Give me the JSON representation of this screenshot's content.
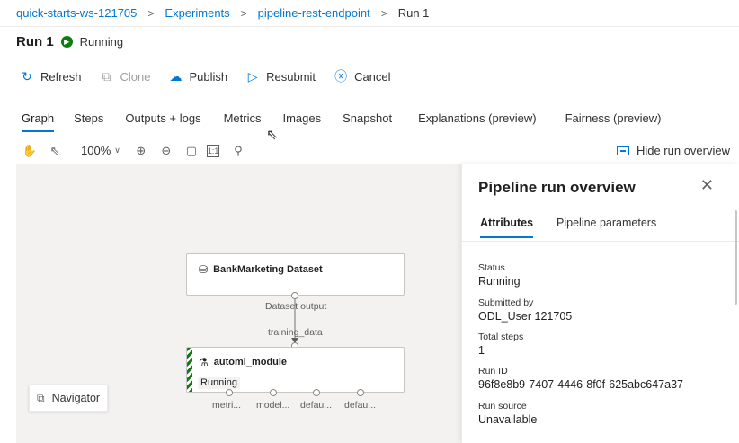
{
  "breadcrumb": {
    "items": [
      "quick-starts-ws-121705",
      "Experiments",
      "pipeline-rest-endpoint",
      "Run 1"
    ],
    "separator": ">"
  },
  "header": {
    "title": "Run 1",
    "status": "Running",
    "status_color": "#107c10"
  },
  "toolbar": {
    "refresh_label": "Refresh",
    "clone_label": "Clone",
    "publish_label": "Publish",
    "resubmit_label": "Resubmit",
    "cancel_label": "Cancel"
  },
  "tabs": [
    {
      "label": "Graph",
      "active": true
    },
    {
      "label": "Steps"
    },
    {
      "label": "Outputs + logs"
    },
    {
      "label": "Metrics"
    },
    {
      "label": "Images"
    },
    {
      "label": "Snapshot"
    },
    {
      "label": "Explanations (preview)"
    },
    {
      "label": "Fairness (preview)"
    }
  ],
  "graph_toolbar": {
    "zoom": "100%",
    "hide_overview_label": "Hide run overview"
  },
  "graph": {
    "dataset_node": {
      "title": "BankMarketing Dataset",
      "output_port": "Dataset output"
    },
    "module_node": {
      "input_port": "training_data",
      "title": "automl_module",
      "status": "Running",
      "output_ports": [
        "metri...",
        "model...",
        "defau...",
        "defau..."
      ]
    },
    "navigator_label": "Navigator"
  },
  "overview": {
    "title": "Pipeline run overview",
    "tabs": [
      "Attributes",
      "Pipeline parameters"
    ],
    "attributes": [
      {
        "label": "Status",
        "value": "Running"
      },
      {
        "label": "Submitted by",
        "value": "ODL_User 121705"
      },
      {
        "label": "Total steps",
        "value": "1"
      },
      {
        "label": "Run ID",
        "value": "96f8e8b9-7407-4446-8f0f-625abc647a37"
      },
      {
        "label": "Run source",
        "value": "Unavailable"
      }
    ]
  },
  "colors": {
    "accent": "#0078d4",
    "running": "#107c10"
  }
}
